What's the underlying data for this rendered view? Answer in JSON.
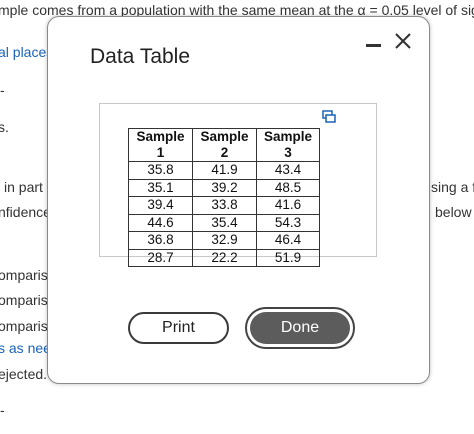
{
  "background": {
    "top_line": "mple comes from a population with the same mean at the α = 0.05 level of signifi",
    "frag_places": "al places",
    "frag_dash1": "-",
    "frag_s": "s.",
    "frag_in_part": "in part",
    "frag_confidence": "nfidence",
    "frag_using": "sing a fa",
    "frag_below": "below",
    "frag_compare1": "omparis",
    "frag_compare2": "omparis",
    "frag_compare3": "omparis",
    "frag_as_need": "s as nee",
    "frag_rejected": "ejected.",
    "frag_dash2": "-"
  },
  "dialog": {
    "title": "Data Table",
    "copy_icon": "copy-icon",
    "table": {
      "headers": [
        "Sample 1",
        "Sample 2",
        "Sample 3"
      ],
      "rows": [
        [
          "35.8",
          "41.9",
          "43.4"
        ],
        [
          "35.1",
          "39.2",
          "48.5"
        ],
        [
          "39.4",
          "33.8",
          "41.6"
        ],
        [
          "44.6",
          "35.4",
          "54.3"
        ],
        [
          "36.8",
          "32.9",
          "46.4"
        ],
        [
          "28.7",
          "22.2",
          "51.9"
        ]
      ]
    },
    "print_label": "Print",
    "done_label": "Done"
  }
}
